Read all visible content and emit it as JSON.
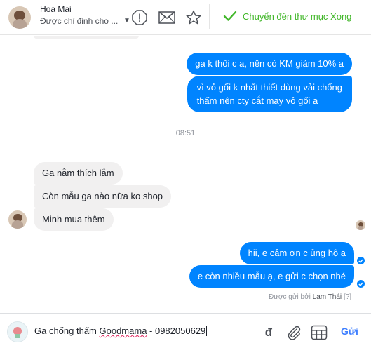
{
  "header": {
    "contact_name": "Hoa Mai",
    "assigned_placeholder": "Được chỉ định cho ...",
    "icons": [
      "alert-icon",
      "envelope-icon",
      "star-icon",
      "checkmark-icon"
    ],
    "move_done_label": "Chuyển đến thư mục Xong",
    "accent_color": "#42b72a"
  },
  "thread": {
    "outgoing_top": [
      "ga k thôi c a, nên có KM giảm 10% a",
      "vì vỏ gối k nhất thiết dùng vải chống",
      "thấm nên cty cắt may vỏ gối a"
    ],
    "timestamp": "08:51",
    "incoming": [
      "Ga nằm thích lắm",
      "Còn mẫu ga nào nữa ko shop",
      "Minh mua thêm"
    ],
    "outgoing_bottom": [
      "hii, e cảm ơn c ủng hộ ạ",
      "e còn nhiều mẫu ạ, e gửi c chọn nhé"
    ],
    "sent_by_prefix": "Được gửi bởi",
    "sent_by_name": "Lam Thái",
    "sent_by_help": "[?]",
    "outgoing_color": "#0084ff",
    "incoming_color": "#f1f0f0"
  },
  "composer": {
    "text_before": "Ga chống thấm ",
    "text_misspelled": "Goodmama",
    "text_after": " - 0982050629",
    "currency_symbol": "đ",
    "icons": [
      "attachment-icon",
      "template-icon"
    ],
    "send_label": "Gửi",
    "send_color": "#4080ff"
  }
}
